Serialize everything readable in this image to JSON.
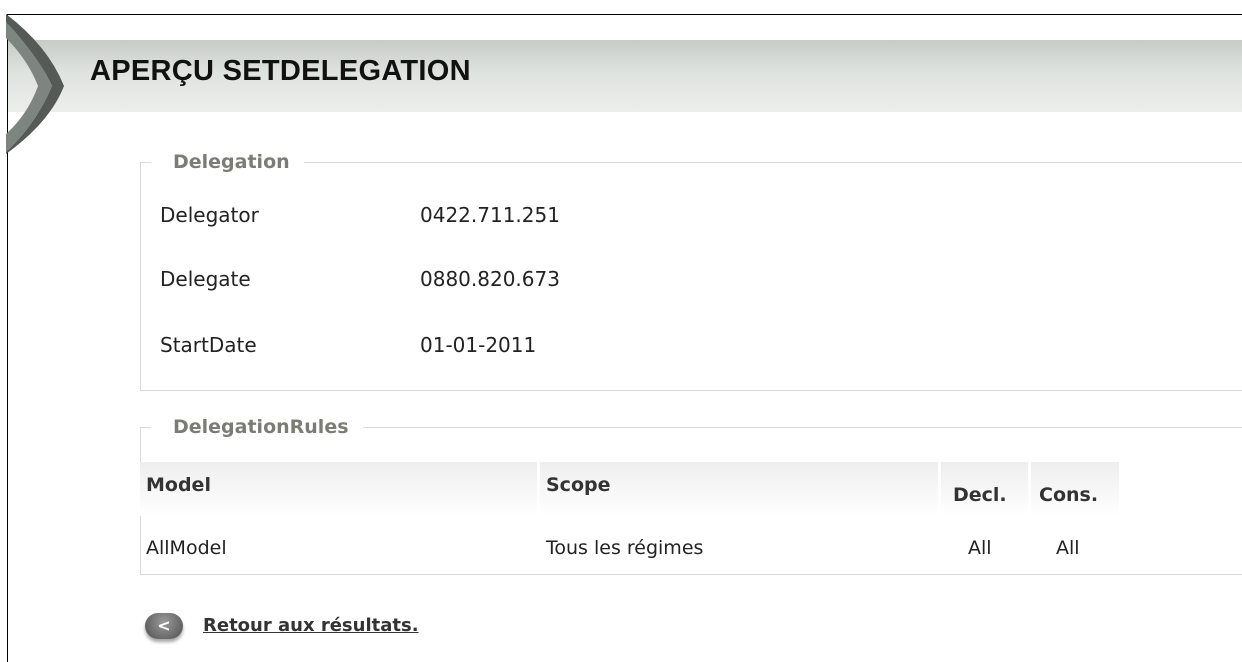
{
  "page": {
    "title": "APERÇU SETDELEGATION"
  },
  "delegation": {
    "legend": "Delegation",
    "fields": [
      {
        "label": "Delegator",
        "value": "0422.711.251"
      },
      {
        "label": "Delegate",
        "value": "0880.820.673"
      },
      {
        "label": "StartDate",
        "value": "01-01-2011"
      }
    ]
  },
  "rules": {
    "legend": "DelegationRules",
    "columns": [
      "Model",
      "Scope",
      "Decl.",
      "Cons."
    ],
    "rows": [
      [
        "AllModel",
        "Tous les régimes",
        "All",
        "All"
      ]
    ]
  },
  "back": {
    "icon": "chevron-left-icon",
    "glyph": "<",
    "label": "Retour aux résultats."
  }
}
